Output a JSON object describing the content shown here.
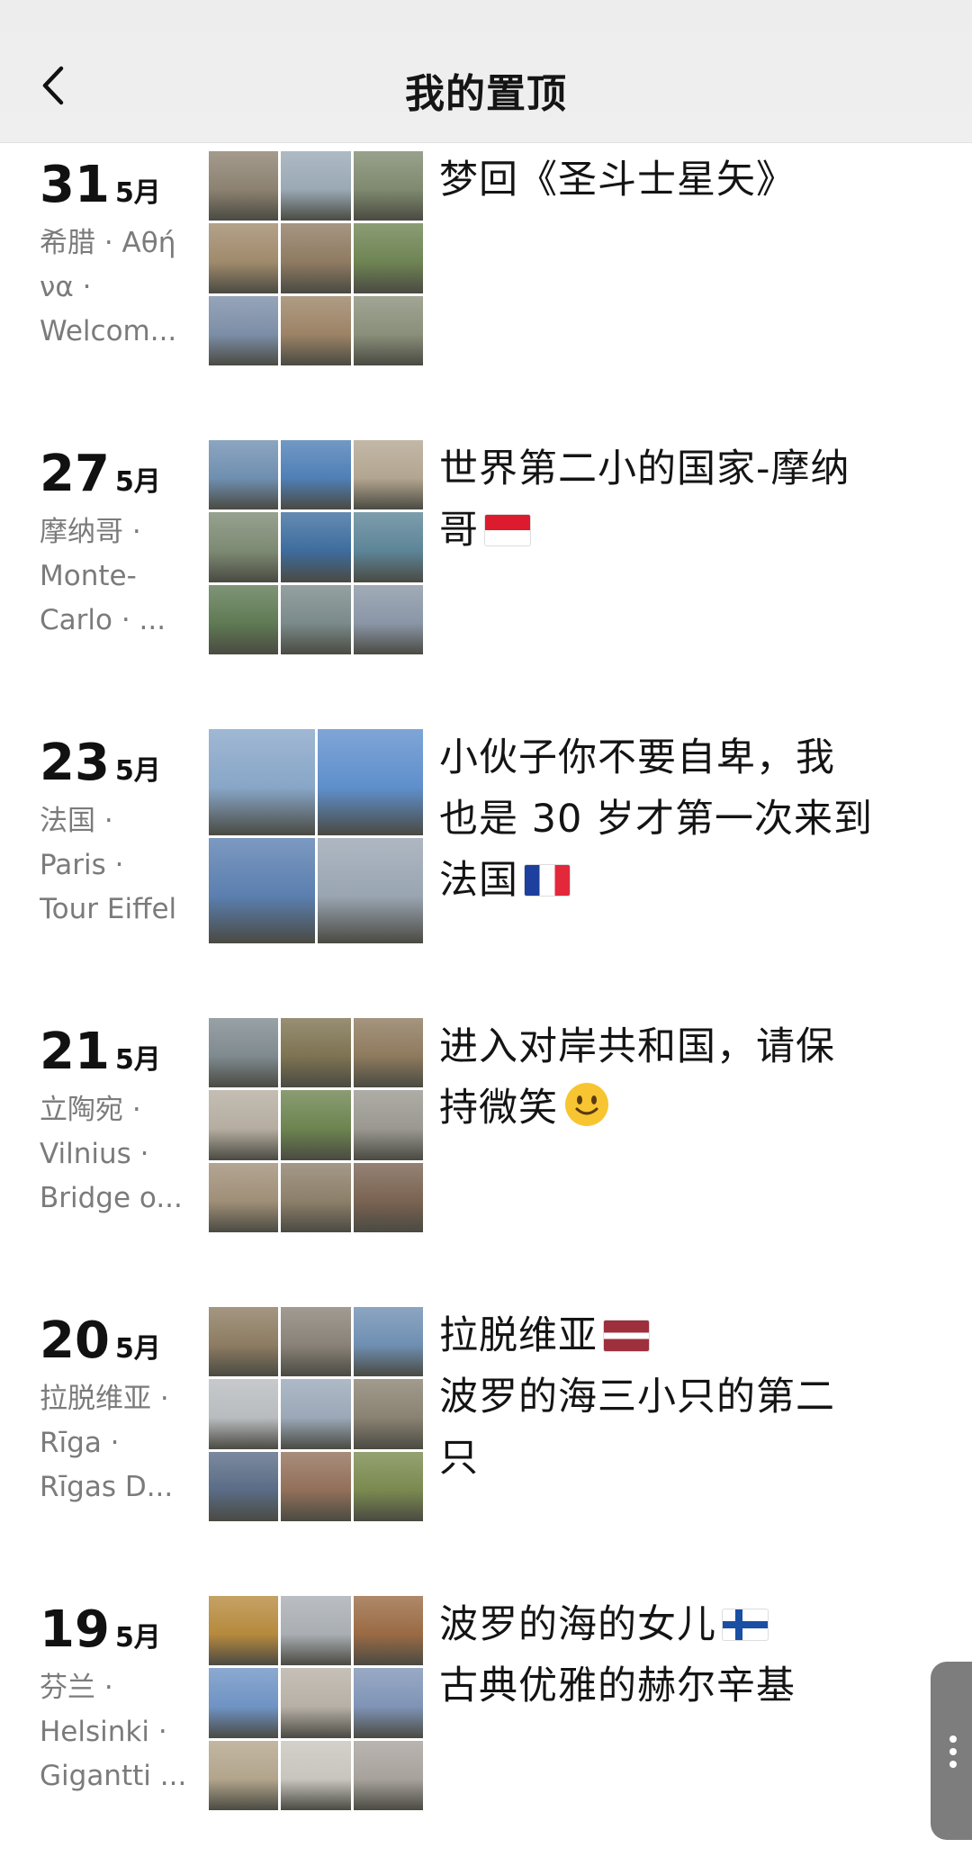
{
  "header": {
    "title": "我的置顶"
  },
  "posts": [
    {
      "day": "31",
      "month": "5月",
      "location": [
        "希腊 · Αθή",
        "να ·",
        "Welcom..."
      ],
      "caption": [
        "梦回《圣斗士星矢》"
      ],
      "flag": "",
      "photo_count": 9,
      "colors": [
        "#8d8271",
        "#9aa9b5",
        "#7f8a6f",
        "#a08a6c",
        "#8f7b62",
        "#6f8453",
        "#7c8ea7",
        "#9c8366",
        "#8a8f7a"
      ]
    },
    {
      "day": "27",
      "month": "5月",
      "location": [
        "摩纳哥 ·",
        "Monte-",
        "Carlo · ..."
      ],
      "caption": [
        "世界第二小的国家-摩纳",
        "哥"
      ],
      "flag": "monaco-flag",
      "photo_count": 9,
      "colors": [
        "#6f8fb0",
        "#4f7fb6",
        "#b3a690",
        "#7d8a73",
        "#3e6d9e",
        "#5d8598",
        "#5f7a54",
        "#7b8a8a",
        "#8a96a6"
      ]
    },
    {
      "day": "23",
      "month": "5月",
      "location": [
        "法国 ·",
        "Paris ·",
        "Tour Eiffel"
      ],
      "caption": [
        "小伙子你不要自卑，我",
        "也是 30 岁才第一次来到",
        "法国"
      ],
      "flag": "france-flag",
      "photo_count": 4,
      "colors": [
        "#88a6c8",
        "#5f8fcc",
        "#5b7fb0",
        "#9aa5b2"
      ]
    },
    {
      "day": "21",
      "month": "5月",
      "location": [
        "立陶宛 ·",
        "Vilnius ·",
        "Bridge o..."
      ],
      "caption": [
        "进入对岸共和国，请保",
        "持微笑"
      ],
      "flag": "smile-emoji",
      "photo_count": 9,
      "colors": [
        "#7f8a8f",
        "#7e7352",
        "#8e7a5e",
        "#b5ada0",
        "#6d8450",
        "#9a9890",
        "#a08f78",
        "#8d7f6a",
        "#7a6352"
      ]
    },
    {
      "day": "20",
      "month": "5月",
      "location": [
        "拉脱维亚 ·",
        "Rīga ·",
        "Rīgas D..."
      ],
      "caption": [
        "拉脱维亚",
        "波罗的海三小只的第二",
        "只"
      ],
      "flag": "latvia-flag",
      "photo_count": 9,
      "colors": [
        "#8d7c62",
        "#8a8278",
        "#6f8fb2",
        "#b9bcbf",
        "#9aa8b8",
        "#8a8272",
        "#5a6c86",
        "#92705a",
        "#7a8a4f"
      ]
    },
    {
      "day": "19",
      "month": "5月",
      "location": [
        "芬兰 ·",
        "Helsinki ·",
        "Gigantti ..."
      ],
      "caption": [
        "波罗的海的女儿",
        "古典优雅的赫尔辛基"
      ],
      "flag": "finland-flag",
      "photo_count": 9,
      "colors": [
        "#b68a3e",
        "#a9aeb3",
        "#9a6b44",
        "#6f93c4",
        "#b7b0a6",
        "#7f94b6",
        "#b3a58c",
        "#c8c5bd",
        "#a8a29c"
      ]
    }
  ]
}
